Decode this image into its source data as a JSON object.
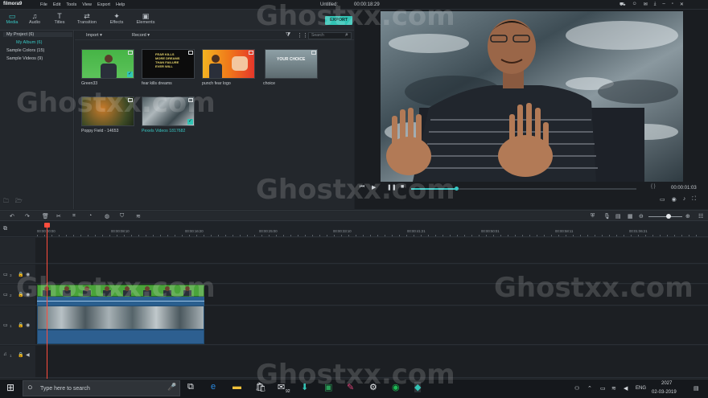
{
  "app": {
    "logo": "filmora9",
    "menu": [
      "File",
      "Edit",
      "Tools",
      "View",
      "Export",
      "Help"
    ],
    "project_title": "Untitled:",
    "project_time": "00:00:18:29"
  },
  "tabs": [
    {
      "label": "Media",
      "icon": "folder-icon"
    },
    {
      "label": "Audio",
      "icon": "music-note-icon"
    },
    {
      "label": "Titles",
      "icon": "text-icon"
    },
    {
      "label": "Transition",
      "icon": "transition-icon"
    },
    {
      "label": "Effects",
      "icon": "effects-icon"
    },
    {
      "label": "Elements",
      "icon": "elements-icon"
    }
  ],
  "export_label": "EXPORT",
  "tree": {
    "items": [
      {
        "label": "My Project (6)"
      },
      {
        "label": "My Album (6)"
      },
      {
        "label": "Sample Colors (15)"
      },
      {
        "label": "Sample Videos (9)"
      }
    ]
  },
  "media_toolbar": {
    "import_label": "Import",
    "record_label": "Record",
    "search_placeholder": "Search"
  },
  "media_items": [
    {
      "label": "Green33"
    },
    {
      "label": "fear kills dreams"
    },
    {
      "label": "punch fear logo"
    },
    {
      "label": "choice"
    },
    {
      "label": "Poppy Field - 14653"
    },
    {
      "label": "Pexels Videos 1817682"
    }
  ],
  "thumb_text": {
    "fear": "FEAR KILLS MORE DREAMS THAN FAILURE EVER WILL",
    "choice": "YOUR CHOICE"
  },
  "preview": {
    "time": "00:00:01:03",
    "progress": 0.2
  },
  "ruler_ticks": [
    "00:00:00:00",
    "00:00:08:10",
    "00:00:16:20",
    "00:00:25:00",
    "00:00:33:10",
    "00:00:41:21",
    "00:00:50:01",
    "00:00:58:11",
    "00:01:06:21"
  ],
  "tracks": [
    {
      "label": "3"
    },
    {
      "label": "2"
    },
    {
      "label": "1"
    },
    {
      "label": "1"
    }
  ],
  "taskbar": {
    "search_placeholder": "Type here to search",
    "language": "ENG",
    "time": "2027",
    "date": "02-03-2019",
    "badge": "92"
  },
  "watermark": "Ghostxx.com",
  "colors": {
    "accent": "#38c6c3",
    "export": "#33c4b5",
    "playhead": "#ff4d3d",
    "clip_green": "#4aa33a",
    "clip_blue": "#2a5f8f"
  }
}
